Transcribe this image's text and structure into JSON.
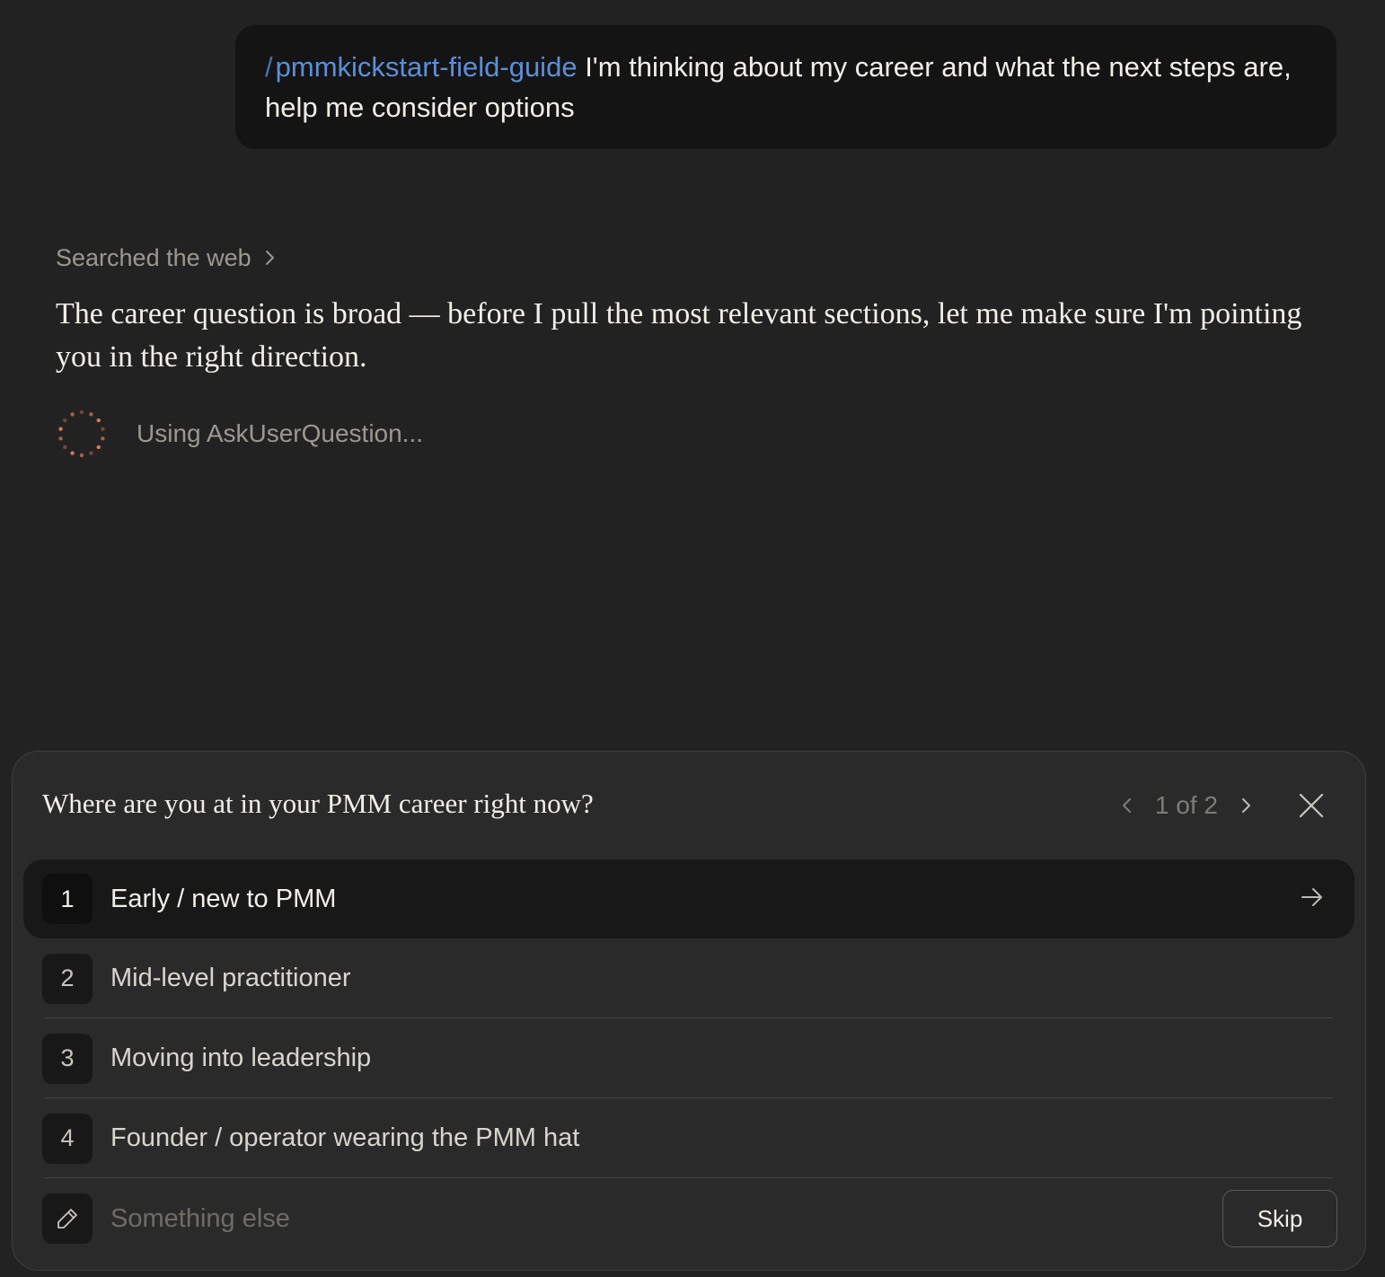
{
  "user_message": {
    "slash_prefix": "/",
    "command": "pmmkickstart-field-guide",
    "text": "I'm thinking about my career and what the next steps are, help me consider options"
  },
  "tool_activity": {
    "label": "Searched the web"
  },
  "assistant": {
    "text": "The career question is broad — before I pull the most relevant sections, let me make sure I'm pointing you in the right direction.",
    "status": "Using AskUserQuestion..."
  },
  "question": {
    "title": "Where are you at in your PMM career right now?",
    "pager": "1 of 2",
    "options": [
      {
        "number": "1",
        "label": "Early / new to PMM"
      },
      {
        "number": "2",
        "label": "Mid-level practitioner"
      },
      {
        "number": "3",
        "label": "Moving into leadership"
      },
      {
        "number": "4",
        "label": "Founder / operator wearing the PMM hat"
      }
    ],
    "other_placeholder": "Something else",
    "skip_label": "Skip"
  },
  "colors": {
    "background": "#222222",
    "bubble": "#141414",
    "panel": "#2a2a2a",
    "command_link": "#5d8ed8",
    "spinner": "#d97757"
  },
  "icons": {
    "tool_expand": "chevron-right-icon",
    "status": "spinner-icon",
    "pager_prev": "chevron-left-icon",
    "pager_next": "chevron-right-icon",
    "close": "close-icon",
    "submit": "arrow-right-icon",
    "other": "pencil-icon"
  }
}
